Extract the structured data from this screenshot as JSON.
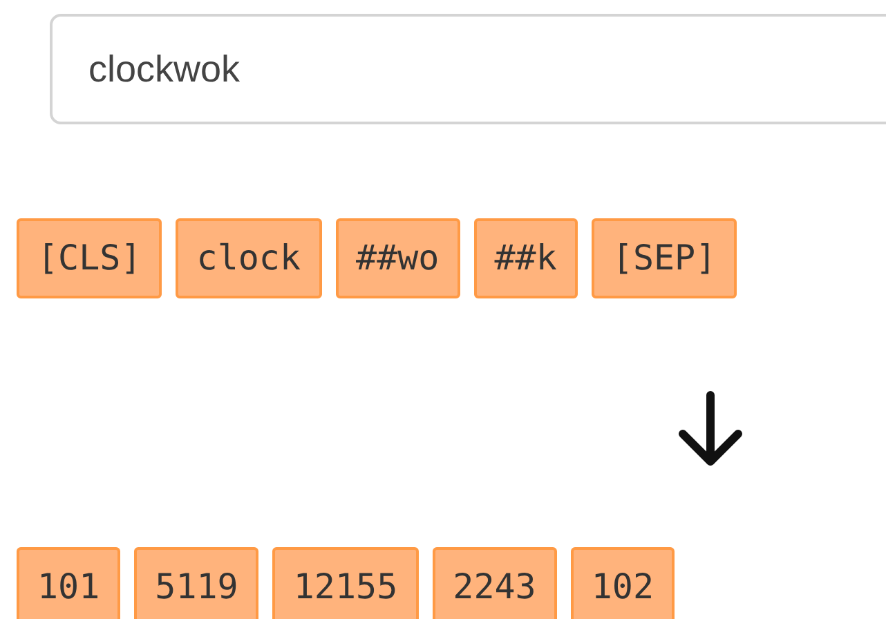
{
  "input": {
    "value": "clockwok"
  },
  "tokens": [
    "[CLS]",
    "clock",
    "##wo",
    "##k",
    "[SEP]"
  ],
  "ids": [
    "101",
    "5119",
    "12155",
    "2243",
    "102"
  ]
}
